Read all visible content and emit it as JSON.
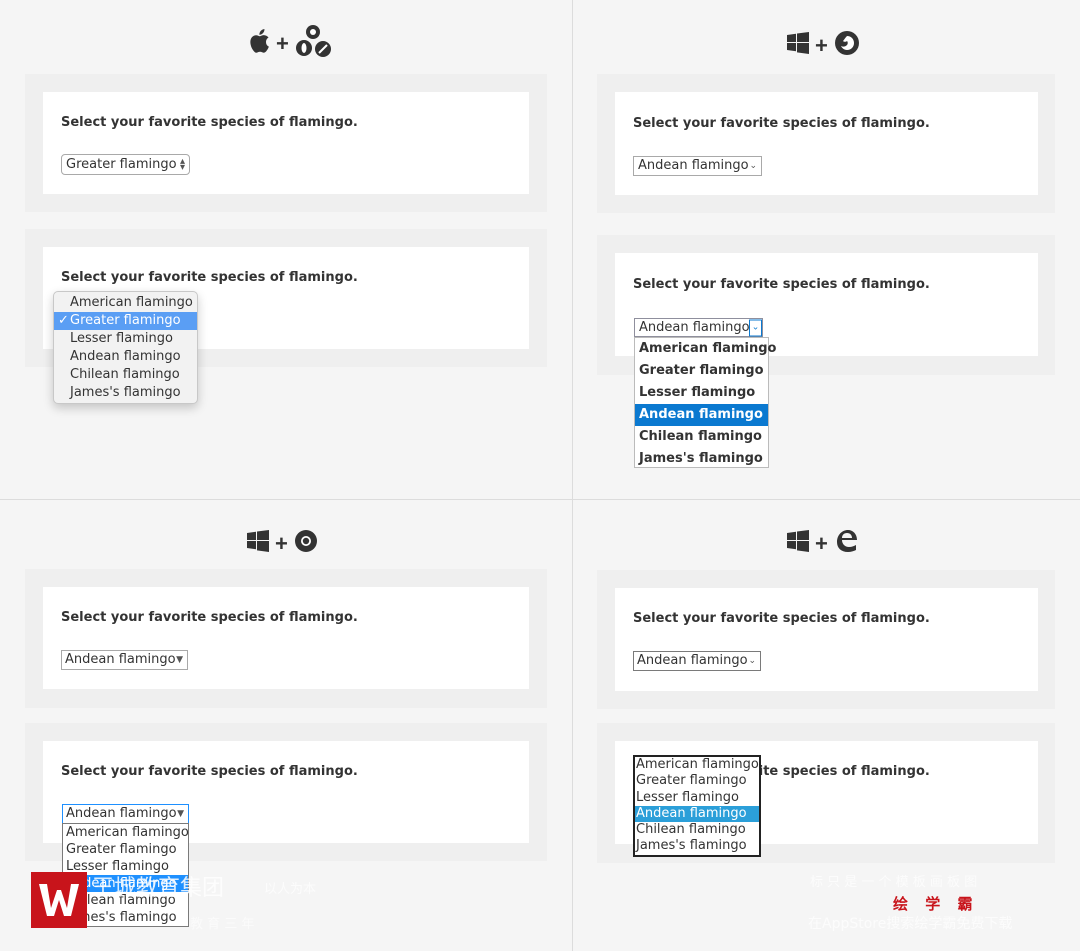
{
  "label_text": "Select your favorite species of flamingo.",
  "options": [
    "American flamingo",
    "Greater flamingo",
    "Lesser flamingo",
    "Andean flamingo",
    "Chilean flamingo",
    "James's flamingo"
  ],
  "q1": {
    "header_icons": [
      "apple-icon",
      "plus",
      "chrome-safari-opera-icon"
    ],
    "closed_value": "Greater flamingo",
    "open_selected": "Greater flamingo",
    "check": "✓"
  },
  "q2": {
    "header_icons": [
      "windows-icon",
      "plus",
      "firefox-icon"
    ],
    "closed_value": "Andean flamingo",
    "open_value": "Andean flamingo",
    "open_selected": "Andean flamingo"
  },
  "q3": {
    "header_icons": [
      "windows-icon",
      "plus",
      "chrome-icon"
    ],
    "closed_value": "Andean flamingo",
    "open_value": "Andean flamingo",
    "open_selected": "Andean flamingo"
  },
  "q4": {
    "header_icons": [
      "windows-icon",
      "plus",
      "edge-icon"
    ],
    "closed_value": "Andean flamingo",
    "open_selected": "Andean flamingo"
  },
  "watermark": {
    "brand": "王城教育集团",
    "tag1": "以人为本",
    "tag2": "教 育 三 年",
    "right_line1": "标 只 是 一 个 模 板 画 板 图",
    "right_red": "绘 学 霸",
    "right_line2": "在AppStore搜索绘学霸免费下载"
  },
  "colors": {
    "accent": "#0b79d0",
    "mac_select": "#5a9ef4",
    "brand_red": "#c8141b"
  }
}
